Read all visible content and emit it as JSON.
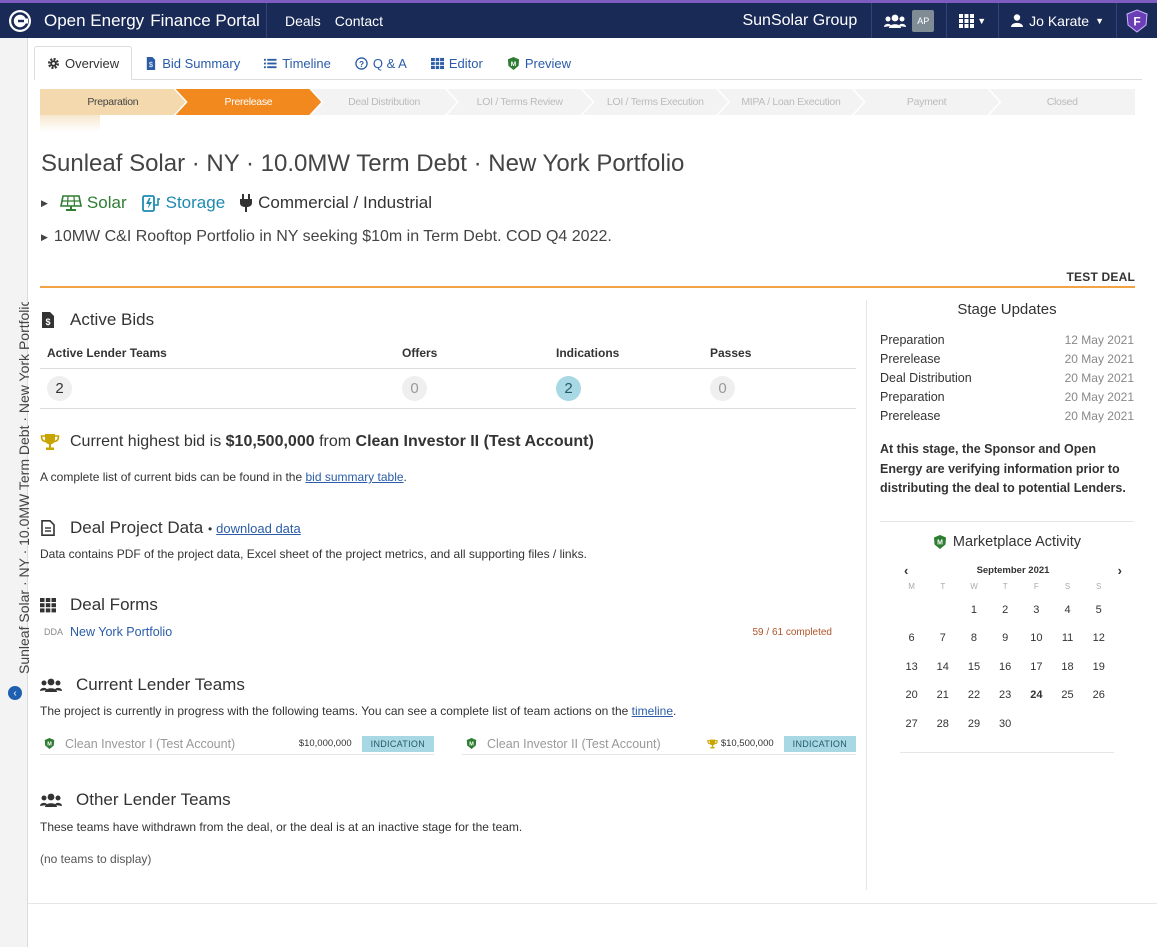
{
  "navbar": {
    "brand_open": "Open Energy",
    "brand_portal": "Finance Portal",
    "links": [
      "Deals",
      "Contact"
    ],
    "org": "SunSolar Group",
    "avatar_initials": "AP",
    "user_name": "Jo Karate",
    "badge_letter": "F"
  },
  "rail": {
    "text": "Sunleaf Solar · NY · 10.0MW Term Debt · New York Portfolio"
  },
  "tabs": [
    {
      "label": "Overview",
      "icon": "gear-icon"
    },
    {
      "label": "Bid Summary",
      "icon": "dollar-doc-icon"
    },
    {
      "label": "Timeline",
      "icon": "list-icon"
    },
    {
      "label": "Q & A",
      "icon": "question-icon"
    },
    {
      "label": "Editor",
      "icon": "grid-icon"
    },
    {
      "label": "Preview",
      "icon": "shield-logo-icon"
    }
  ],
  "stages": [
    "Preparation",
    "Prerelease",
    "Deal Distribution",
    "LOI / Terms Review",
    "LOI / Terms Execution",
    "MIPA / Loan Execution",
    "Payment",
    "Closed"
  ],
  "deal": {
    "title": "Sunleaf Solar · NY · 10.0MW Term Debt · New York Portfolio",
    "tag_solar": "Solar",
    "tag_storage": "Storage",
    "tag_ci": "Commercial / Industrial",
    "summary": "10MW C&I Rooftop Portfolio in NY seeking $10m in Term Debt. COD Q4 2022.",
    "test_label": "TEST DEAL"
  },
  "active_bids": {
    "title": "Active Bids",
    "headers": [
      "Active Lender Teams",
      "Offers",
      "Indications",
      "Passes"
    ],
    "values": [
      "2",
      "0",
      "2",
      "0"
    ]
  },
  "highest_bid": {
    "prefix": "Current highest bid is",
    "amount": "$10,500,000",
    "from": "from",
    "investor": "Clean Investor II (Test Account)",
    "note_prefix": "A complete list of current bids can be found in the",
    "note_link": "bid summary table",
    "note_suffix": "."
  },
  "project_data": {
    "title": "Deal Project Data",
    "separator": "•",
    "link": "download data",
    "note": "Data contains PDF of the project data, Excel sheet of the project metrics, and all supporting files / links."
  },
  "deal_forms": {
    "title": "Deal Forms",
    "code": "DDA",
    "name": "New York Portfolio",
    "progress": "59 / 61 completed"
  },
  "current_teams": {
    "title": "Current Lender Teams",
    "note_prefix": "The project is currently in progress with the following teams. You can see a complete list of team actions on the",
    "note_link": "timeline",
    "note_suffix": ".",
    "teams": [
      {
        "name": "Clean Investor I (Test Account)",
        "amount": "$10,000,000",
        "status": "INDICATION"
      },
      {
        "name": "Clean Investor II (Test Account)",
        "amount": "$10,500,000",
        "status": "INDICATION"
      }
    ]
  },
  "other_teams": {
    "title": "Other Lender Teams",
    "note": "These teams have withdrawn from the deal, or the deal is at an inactive stage for the team.",
    "empty": "(no teams to display)"
  },
  "stage_updates": {
    "title": "Stage Updates",
    "rows": [
      {
        "stage": "Preparation",
        "date": "12 May 2021"
      },
      {
        "stage": "Prerelease",
        "date": "20 May 2021"
      },
      {
        "stage": "Deal Distribution",
        "date": "20 May 2021"
      },
      {
        "stage": "Preparation",
        "date": "20 May 2021"
      },
      {
        "stage": "Prerelease",
        "date": "20 May 2021"
      }
    ],
    "note": "At this stage, the Sponsor and Open Energy are verifying information prior to distributing the deal to potential Lenders."
  },
  "marketplace": {
    "title": "Marketplace Activity",
    "month": "September 2021",
    "prev": "‹",
    "next": "›",
    "dow": [
      "M",
      "T",
      "W",
      "T",
      "F",
      "S",
      "S"
    ],
    "days": [
      "",
      "",
      "1",
      "2",
      "3",
      "4",
      "5",
      "6",
      "7",
      "8",
      "9",
      "10",
      "11",
      "12",
      "13",
      "14",
      "15",
      "16",
      "17",
      "18",
      "19",
      "20",
      "21",
      "22",
      "23",
      "24",
      "25",
      "26",
      "27",
      "28",
      "29",
      "30",
      "",
      "",
      ""
    ],
    "today": "24"
  },
  "colors": {
    "navbar": "#1a2a57",
    "stage_done": "#f3d9ad",
    "stage_current": "#f2891e",
    "indication": "#a8d8e3",
    "link": "#2a5ca8"
  }
}
